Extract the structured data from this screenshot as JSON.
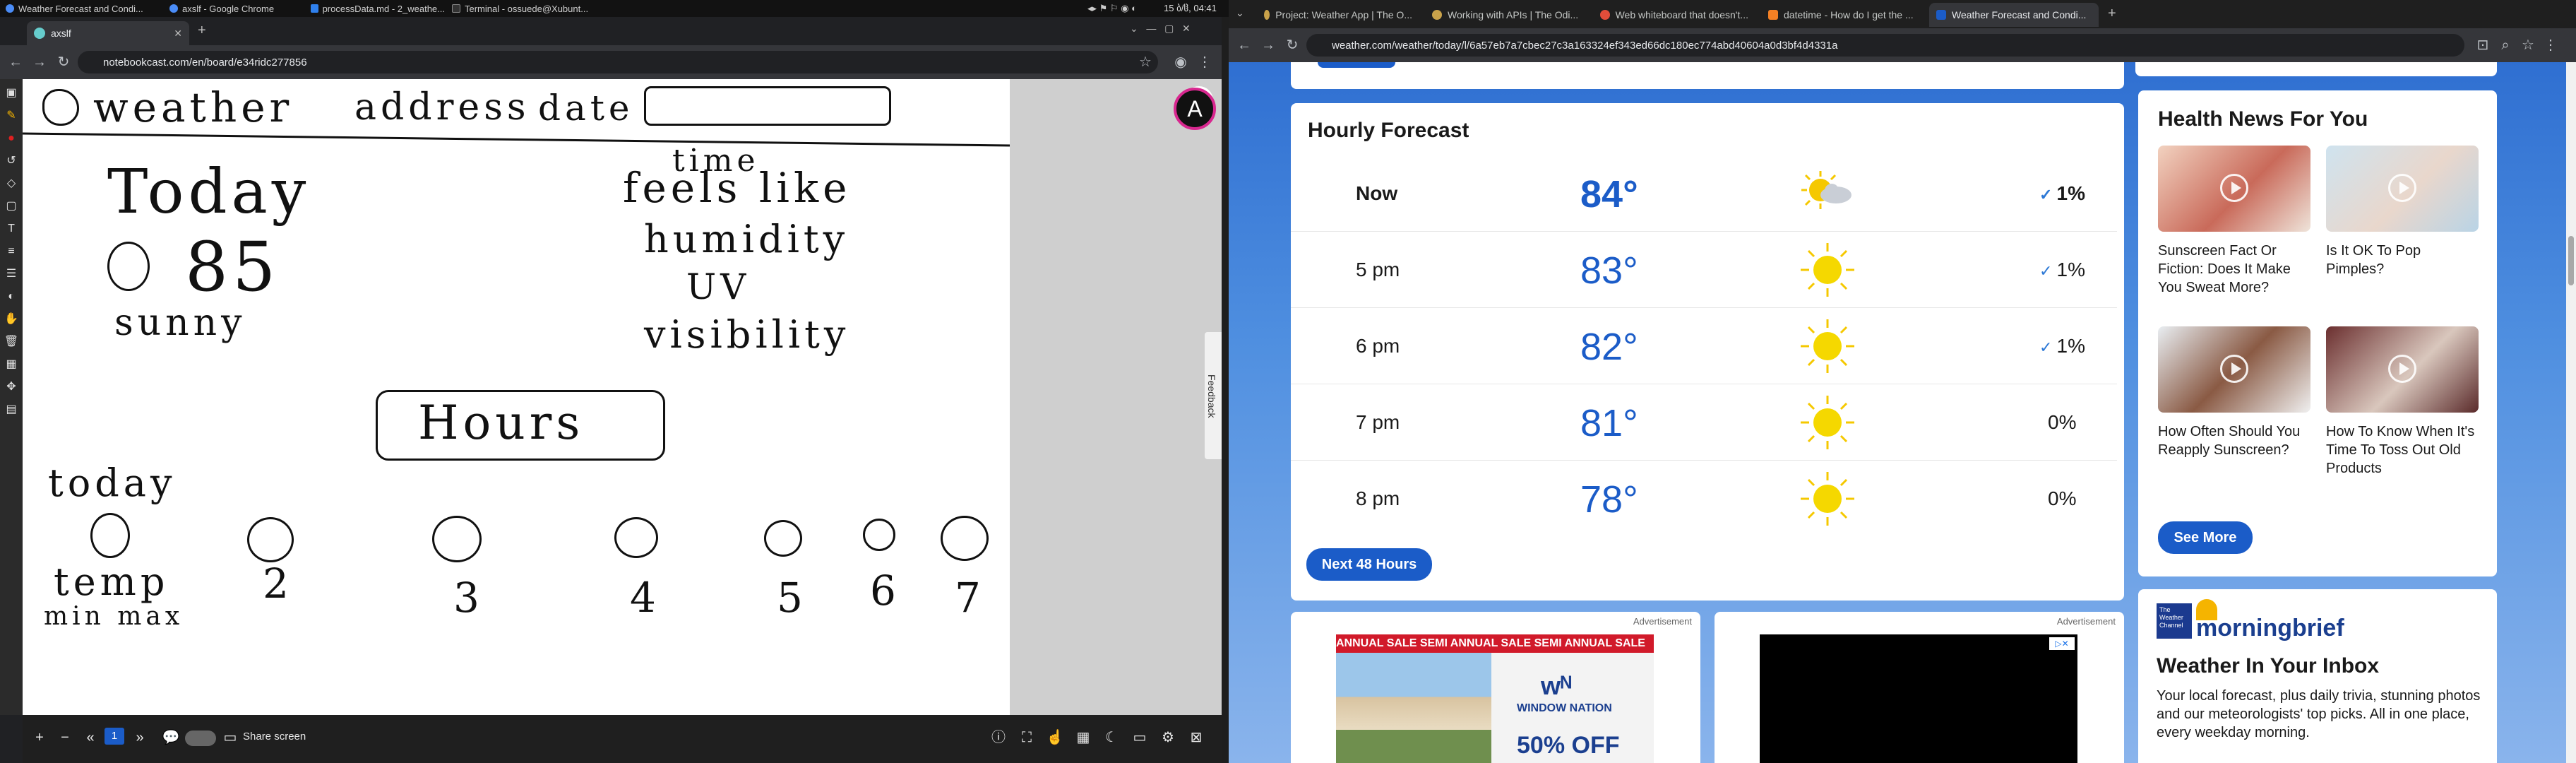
{
  "os": {
    "tabs": [
      "Weather Forecast and Condi...",
      "axslf - Google Chrome",
      "processData.md - 2_weathe...",
      "Terminal - ossuede@Xubunt..."
    ],
    "clock": "15 ბ/ჱ, 04:41"
  },
  "left_browser": {
    "tab_title": "axslf",
    "url": "notebookcast.com/en/board/e34ridc277856",
    "avatar_letter": "A",
    "feedback_label": "Feedback",
    "bottom": {
      "page": "1",
      "share": "Share screen"
    },
    "whiteboard": {
      "line1": [
        "weather",
        "address",
        "date"
      ],
      "time": "time",
      "today": "Today",
      "temp_big": "85",
      "sunny": "sunny",
      "feels": "feels like",
      "humidity": "humidity",
      "uv": "UV",
      "visibility": "visibility",
      "hours": "Hours",
      "today_small": "today",
      "temp": "temp",
      "minmax": "min max",
      "numbers": [
        "2",
        "3",
        "4",
        "5",
        "6",
        "7"
      ]
    }
  },
  "right_browser": {
    "tabs": [
      "Project: Weather App | The O...",
      "Working with APIs | The Odi...",
      "Web whiteboard that doesn't...",
      "datetime - How do I get the ...",
      "Weather Forecast and Condi..."
    ],
    "url": "weather.com/weather/today/l/6a57eb7a7cbec27c3a163324ef343ed66dc180ec774abd40604a0d3bf4d4331a",
    "hourly": {
      "title": "Hourly Forecast",
      "rows": [
        {
          "time": "Now",
          "temp": "84°",
          "icon": "partly-sunny-icon",
          "precip": "1%",
          "drop": true
        },
        {
          "time": "5 pm",
          "temp": "83°",
          "icon": "sun-icon",
          "precip": "1%",
          "drop": true
        },
        {
          "time": "6 pm",
          "temp": "82°",
          "icon": "sun-icon",
          "precip": "1%",
          "drop": true
        },
        {
          "time": "7 pm",
          "temp": "81°",
          "icon": "sun-icon",
          "precip": "0%",
          "drop": false
        },
        {
          "time": "8 pm",
          "temp": "78°",
          "icon": "sun-icon",
          "precip": "0%",
          "drop": false
        }
      ],
      "button": "Next 48 Hours"
    },
    "health": {
      "title": "Health News For You",
      "items": [
        "Sunscreen Fact Or Fiction: Does It Make You Sweat More?",
        "Is It OK To Pop Pimples?",
        "How Often Should You Reapply Sunscreen?",
        "How To Know When It's Time To Toss Out Old Products"
      ],
      "button": "See More"
    },
    "ads": {
      "label": "Advertisement",
      "banner": "ANNUAL SALE SEMI ANNUAL SALE SEMI ANNUAL SALE",
      "brand": "WINDOW NATION",
      "offer": "50% OFF"
    },
    "newsletter": {
      "logo_top": "The Weather Channel",
      "logo_word": "morningbrief",
      "title": "Weather In Your Inbox",
      "body": "Your local forecast, plus daily trivia, stunning photos and our meteorologists' top picks. All in one place, every weekday morning."
    }
  }
}
